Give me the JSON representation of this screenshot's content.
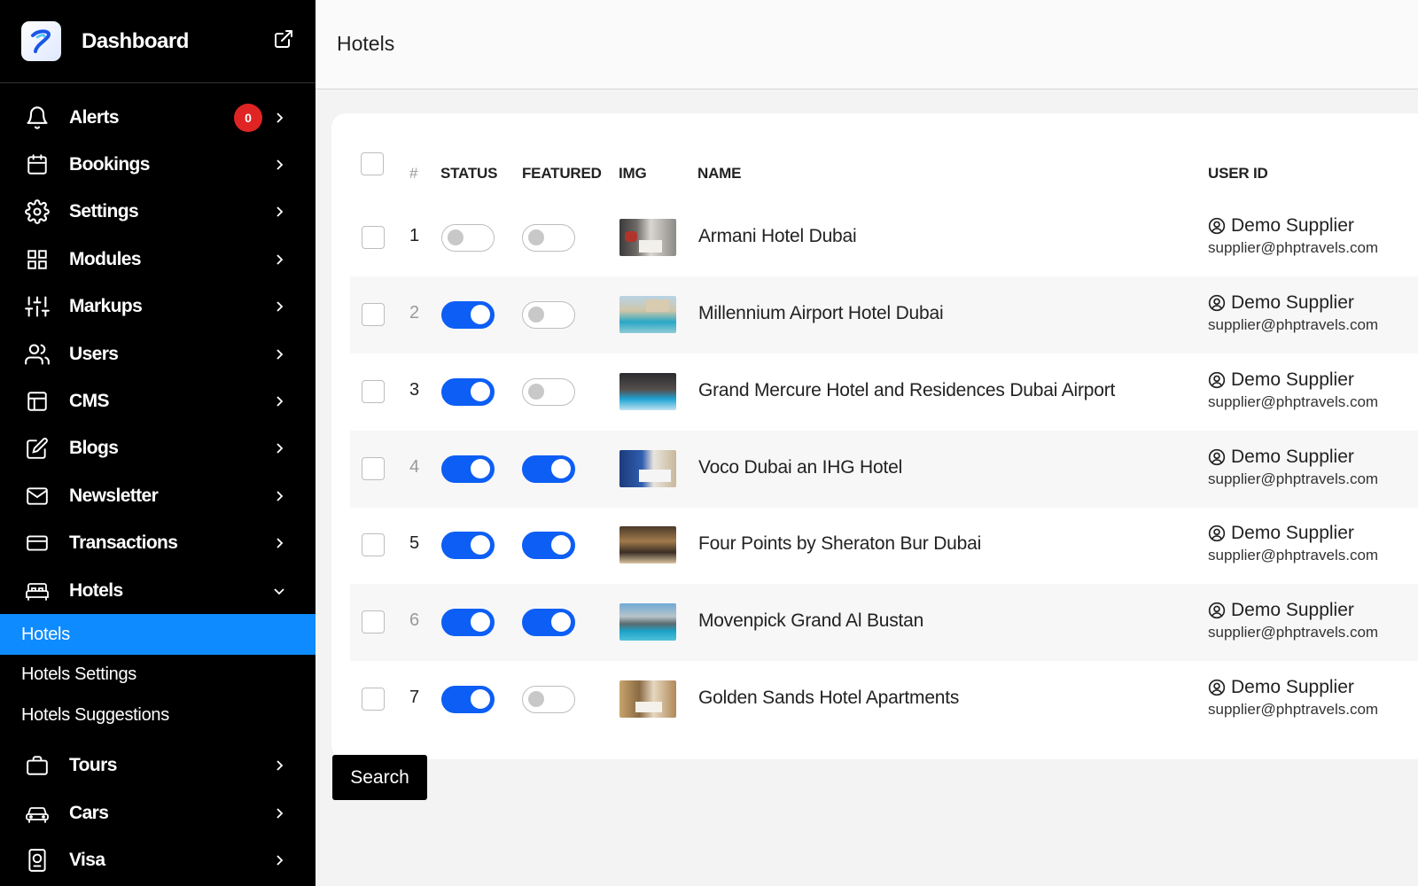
{
  "sidebar": {
    "brand": "Dashboard",
    "items": [
      {
        "label": "Alerts",
        "icon": "bell-icon",
        "badge": "0"
      },
      {
        "label": "Bookings",
        "icon": "calendar-icon"
      },
      {
        "label": "Settings",
        "icon": "gear-icon"
      },
      {
        "label": "Modules",
        "icon": "grid-icon"
      },
      {
        "label": "Markups",
        "icon": "sliders-icon"
      },
      {
        "label": "Users",
        "icon": "users-icon"
      },
      {
        "label": "CMS",
        "icon": "layout-icon"
      },
      {
        "label": "Blogs",
        "icon": "edit-icon"
      },
      {
        "label": "Newsletter",
        "icon": "mail-icon"
      },
      {
        "label": "Transactions",
        "icon": "credit-card-icon"
      },
      {
        "label": "Hotels",
        "icon": "bed-icon",
        "expanded": true
      }
    ],
    "hotels_sub": [
      {
        "label": "Hotels",
        "active": true
      },
      {
        "label": "Hotels Settings"
      },
      {
        "label": "Hotels Suggestions"
      }
    ],
    "items_after": [
      {
        "label": "Tours",
        "icon": "briefcase-icon"
      },
      {
        "label": "Cars",
        "icon": "car-icon"
      },
      {
        "label": "Visa",
        "icon": "passport-icon"
      }
    ]
  },
  "header": {
    "title": "Hotels"
  },
  "table": {
    "columns": {
      "hash": "#",
      "status": "STATUS",
      "featured": "FEATURED",
      "img": "IMG",
      "name": "NAME",
      "user_id": "USER ID"
    },
    "rows": [
      {
        "num": "1",
        "status": false,
        "featured": false,
        "name": "Armani Hotel Dubai",
        "user": "Demo Supplier",
        "email": "supplier@phptravels.com"
      },
      {
        "num": "2",
        "status": true,
        "featured": false,
        "name": "Millennium Airport Hotel Dubai",
        "user": "Demo Supplier",
        "email": "supplier@phptravels.com"
      },
      {
        "num": "3",
        "status": true,
        "featured": false,
        "name": "Grand Mercure Hotel and Residences Dubai Airport",
        "user": "Demo Supplier",
        "email": "supplier@phptravels.com"
      },
      {
        "num": "4",
        "status": true,
        "featured": true,
        "name": "Voco Dubai an IHG Hotel",
        "user": "Demo Supplier",
        "email": "supplier@phptravels.com"
      },
      {
        "num": "5",
        "status": true,
        "featured": true,
        "name": "Four Points by Sheraton Bur Dubai",
        "user": "Demo Supplier",
        "email": "supplier@phptravels.com"
      },
      {
        "num": "6",
        "status": true,
        "featured": true,
        "name": "Movenpick Grand Al Bustan",
        "user": "Demo Supplier",
        "email": "supplier@phptravels.com"
      },
      {
        "num": "7",
        "status": true,
        "featured": false,
        "name": "Golden Sands Hotel Apartments",
        "user": "Demo Supplier",
        "email": "supplier@phptravels.com"
      }
    ]
  },
  "search_button": "Search",
  "colors": {
    "sidebar_bg": "#000000",
    "active_item": "#0d8bff",
    "toggle_on": "#0d5ef5",
    "badge": "#e02424",
    "row_alt": "#f7f7f7"
  }
}
